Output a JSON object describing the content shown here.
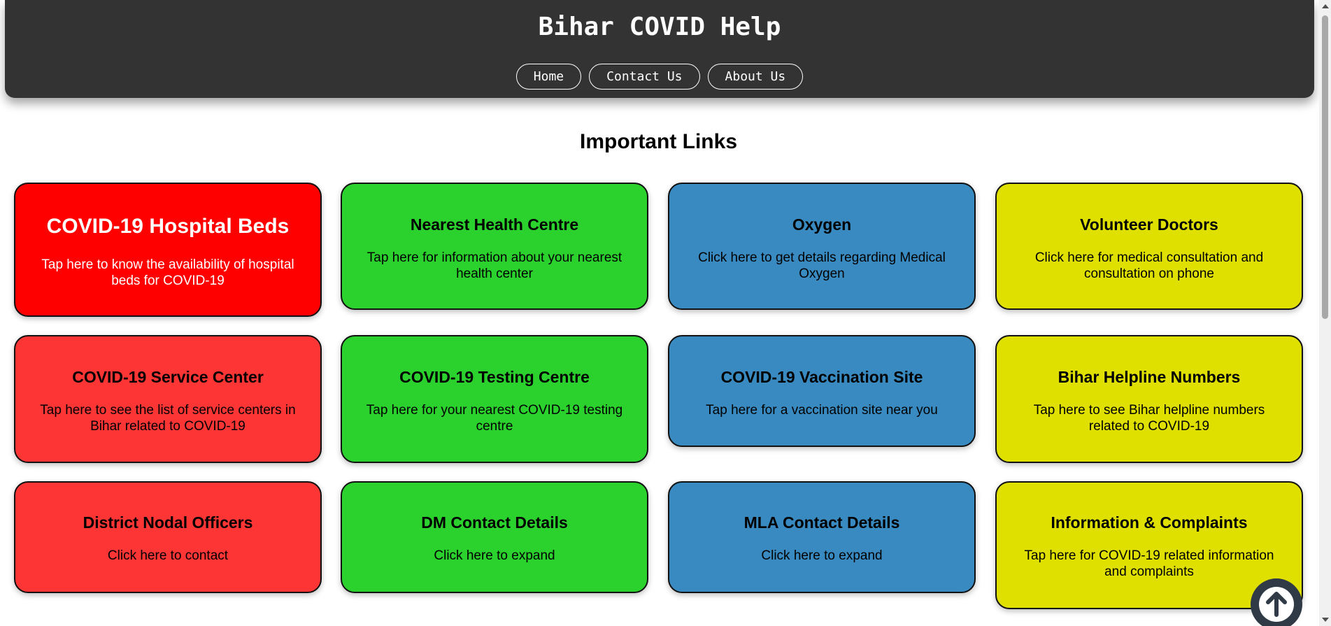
{
  "header": {
    "title": "Bihar COVID Help",
    "nav": [
      {
        "label": "Home"
      },
      {
        "label": "Contact Us"
      },
      {
        "label": "About Us"
      }
    ]
  },
  "main": {
    "section_title": "Important Links",
    "cards": [
      {
        "title": "COVID-19 Hospital Beds",
        "text": "Tap here to know the availability of hospital beds for COVID-19",
        "color": "#fe0000"
      },
      {
        "title": "Nearest Health Centre",
        "text": "Tap here for information about your nearest health center",
        "color": "#2bd22e"
      },
      {
        "title": "Oxygen",
        "text": "Click here to get details regarding Medical Oxygen",
        "color": "#388ac0"
      },
      {
        "title": "Volunteer Doctors",
        "text": "Click here for medical consultation and consultation on phone",
        "color": "#dfe000"
      },
      {
        "title": "COVID-19 Service Center",
        "text": "Tap here to see the list of service centers in Bihar related to COVID-19",
        "color": "#fe3535"
      },
      {
        "title": "COVID-19 Testing Centre",
        "text": "Tap here for your nearest COVID-19 testing centre",
        "color": "#2bd22e"
      },
      {
        "title": "COVID-19 Vaccination Site",
        "text": "Tap here for a vaccination site near you",
        "color": "#388ac0"
      },
      {
        "title": "Bihar Helpline Numbers",
        "text": "Tap here to see Bihar helpline numbers related to COVID-19",
        "color": "#dfe000"
      },
      {
        "title": "District Nodal Officers",
        "text": "Click here to contact",
        "color": "#fe3535"
      },
      {
        "title": "DM Contact Details",
        "text": "Click here to expand",
        "color": "#2bd22e"
      },
      {
        "title": "MLA Contact Details",
        "text": "Click here to expand",
        "color": "#388ac0"
      },
      {
        "title": "Information & Complaints",
        "text": "Tap here for COVID-19 related information and complaints",
        "color": "#dfe000"
      }
    ]
  },
  "back_to_top": {
    "icon": "arrow-up-circle-icon"
  }
}
